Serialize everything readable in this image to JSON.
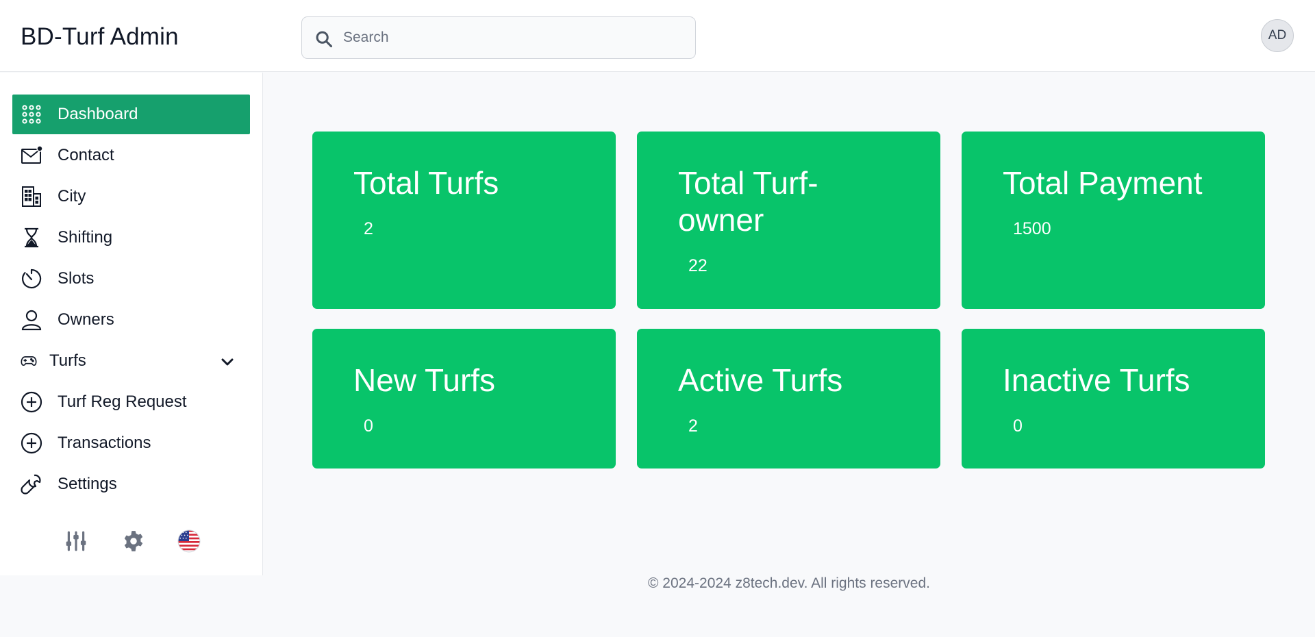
{
  "header": {
    "brand": "BD-Turf Admin",
    "search_placeholder": "Search",
    "avatar_initials": "AD"
  },
  "sidebar": {
    "items": [
      {
        "label": "Dashboard",
        "icon": "grid-dots-icon",
        "active": true
      },
      {
        "label": "Contact",
        "icon": "mail-notification-icon"
      },
      {
        "label": "City",
        "icon": "building-icon"
      },
      {
        "label": "Shifting",
        "icon": "hourglass-icon"
      },
      {
        "label": "Slots",
        "icon": "timer-icon"
      },
      {
        "label": "Owners",
        "icon": "user-icon"
      },
      {
        "label": "Turfs",
        "icon": "gamepad-icon",
        "expandable": true
      },
      {
        "label": "Turf Reg Request",
        "icon": "plus-circle-icon"
      },
      {
        "label": "Transactions",
        "icon": "plus-circle-icon"
      },
      {
        "label": "Settings",
        "icon": "wrench-icon"
      }
    ],
    "tools": [
      "sliders-icon",
      "gear-icon",
      "us-flag-icon"
    ]
  },
  "cards": [
    {
      "title": "Total Turfs",
      "value": "2"
    },
    {
      "title": "Total Turf-owner",
      "value": "22"
    },
    {
      "title": "Total Payment",
      "value": "1500"
    },
    {
      "title": "New Turfs",
      "value": "0"
    },
    {
      "title": "Active Turfs",
      "value": "2"
    },
    {
      "title": "Inactive Turfs",
      "value": "0"
    }
  ],
  "footer": {
    "text": "© 2024-2024 z8tech.dev. All rights reserved."
  },
  "colors": {
    "card_bg": "#08c46a",
    "active_nav_bg": "#16a06d",
    "page_bg": "#f8f9fb"
  }
}
